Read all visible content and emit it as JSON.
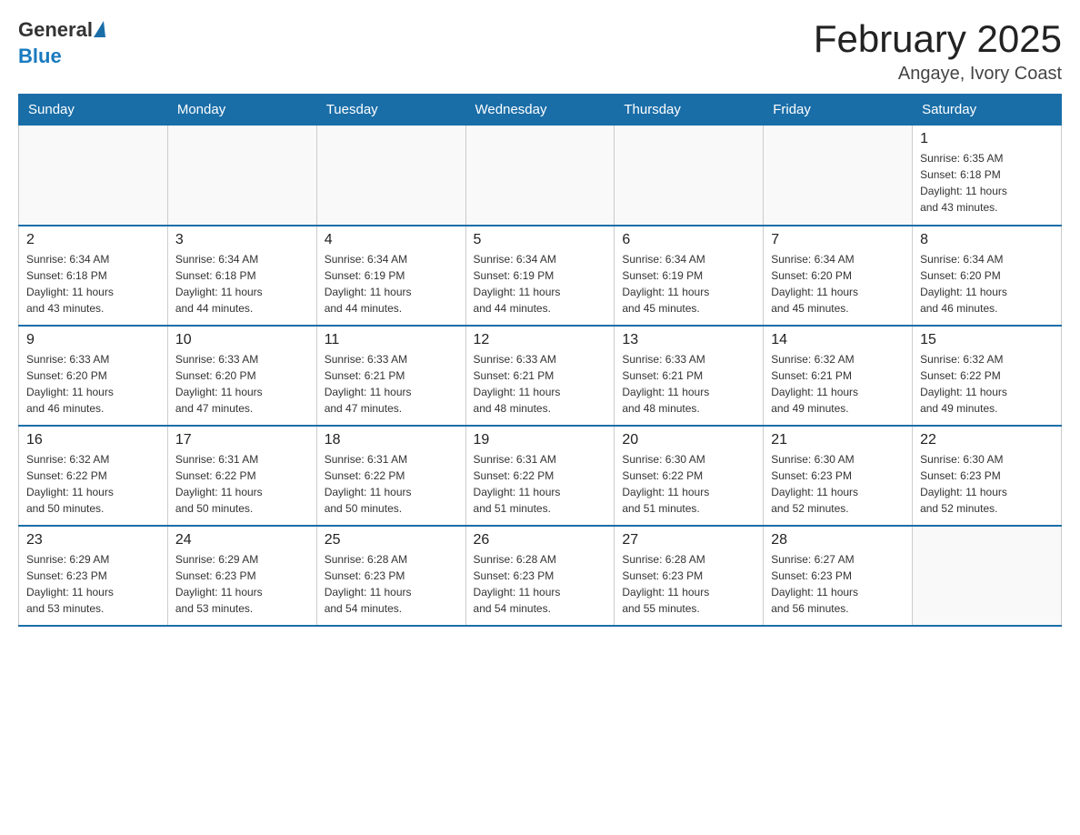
{
  "logo": {
    "general": "General",
    "blue": "Blue"
  },
  "title": "February 2025",
  "location": "Angaye, Ivory Coast",
  "days_of_week": [
    "Sunday",
    "Monday",
    "Tuesday",
    "Wednesday",
    "Thursday",
    "Friday",
    "Saturday"
  ],
  "weeks": [
    [
      {
        "day": "",
        "info": ""
      },
      {
        "day": "",
        "info": ""
      },
      {
        "day": "",
        "info": ""
      },
      {
        "day": "",
        "info": ""
      },
      {
        "day": "",
        "info": ""
      },
      {
        "day": "",
        "info": ""
      },
      {
        "day": "1",
        "info": "Sunrise: 6:35 AM\nSunset: 6:18 PM\nDaylight: 11 hours\nand 43 minutes."
      }
    ],
    [
      {
        "day": "2",
        "info": "Sunrise: 6:34 AM\nSunset: 6:18 PM\nDaylight: 11 hours\nand 43 minutes."
      },
      {
        "day": "3",
        "info": "Sunrise: 6:34 AM\nSunset: 6:18 PM\nDaylight: 11 hours\nand 44 minutes."
      },
      {
        "day": "4",
        "info": "Sunrise: 6:34 AM\nSunset: 6:19 PM\nDaylight: 11 hours\nand 44 minutes."
      },
      {
        "day": "5",
        "info": "Sunrise: 6:34 AM\nSunset: 6:19 PM\nDaylight: 11 hours\nand 44 minutes."
      },
      {
        "day": "6",
        "info": "Sunrise: 6:34 AM\nSunset: 6:19 PM\nDaylight: 11 hours\nand 45 minutes."
      },
      {
        "day": "7",
        "info": "Sunrise: 6:34 AM\nSunset: 6:20 PM\nDaylight: 11 hours\nand 45 minutes."
      },
      {
        "day": "8",
        "info": "Sunrise: 6:34 AM\nSunset: 6:20 PM\nDaylight: 11 hours\nand 46 minutes."
      }
    ],
    [
      {
        "day": "9",
        "info": "Sunrise: 6:33 AM\nSunset: 6:20 PM\nDaylight: 11 hours\nand 46 minutes."
      },
      {
        "day": "10",
        "info": "Sunrise: 6:33 AM\nSunset: 6:20 PM\nDaylight: 11 hours\nand 47 minutes."
      },
      {
        "day": "11",
        "info": "Sunrise: 6:33 AM\nSunset: 6:21 PM\nDaylight: 11 hours\nand 47 minutes."
      },
      {
        "day": "12",
        "info": "Sunrise: 6:33 AM\nSunset: 6:21 PM\nDaylight: 11 hours\nand 48 minutes."
      },
      {
        "day": "13",
        "info": "Sunrise: 6:33 AM\nSunset: 6:21 PM\nDaylight: 11 hours\nand 48 minutes."
      },
      {
        "day": "14",
        "info": "Sunrise: 6:32 AM\nSunset: 6:21 PM\nDaylight: 11 hours\nand 49 minutes."
      },
      {
        "day": "15",
        "info": "Sunrise: 6:32 AM\nSunset: 6:22 PM\nDaylight: 11 hours\nand 49 minutes."
      }
    ],
    [
      {
        "day": "16",
        "info": "Sunrise: 6:32 AM\nSunset: 6:22 PM\nDaylight: 11 hours\nand 50 minutes."
      },
      {
        "day": "17",
        "info": "Sunrise: 6:31 AM\nSunset: 6:22 PM\nDaylight: 11 hours\nand 50 minutes."
      },
      {
        "day": "18",
        "info": "Sunrise: 6:31 AM\nSunset: 6:22 PM\nDaylight: 11 hours\nand 50 minutes."
      },
      {
        "day": "19",
        "info": "Sunrise: 6:31 AM\nSunset: 6:22 PM\nDaylight: 11 hours\nand 51 minutes."
      },
      {
        "day": "20",
        "info": "Sunrise: 6:30 AM\nSunset: 6:22 PM\nDaylight: 11 hours\nand 51 minutes."
      },
      {
        "day": "21",
        "info": "Sunrise: 6:30 AM\nSunset: 6:23 PM\nDaylight: 11 hours\nand 52 minutes."
      },
      {
        "day": "22",
        "info": "Sunrise: 6:30 AM\nSunset: 6:23 PM\nDaylight: 11 hours\nand 52 minutes."
      }
    ],
    [
      {
        "day": "23",
        "info": "Sunrise: 6:29 AM\nSunset: 6:23 PM\nDaylight: 11 hours\nand 53 minutes."
      },
      {
        "day": "24",
        "info": "Sunrise: 6:29 AM\nSunset: 6:23 PM\nDaylight: 11 hours\nand 53 minutes."
      },
      {
        "day": "25",
        "info": "Sunrise: 6:28 AM\nSunset: 6:23 PM\nDaylight: 11 hours\nand 54 minutes."
      },
      {
        "day": "26",
        "info": "Sunrise: 6:28 AM\nSunset: 6:23 PM\nDaylight: 11 hours\nand 54 minutes."
      },
      {
        "day": "27",
        "info": "Sunrise: 6:28 AM\nSunset: 6:23 PM\nDaylight: 11 hours\nand 55 minutes."
      },
      {
        "day": "28",
        "info": "Sunrise: 6:27 AM\nSunset: 6:23 PM\nDaylight: 11 hours\nand 56 minutes."
      },
      {
        "day": "",
        "info": ""
      }
    ]
  ]
}
